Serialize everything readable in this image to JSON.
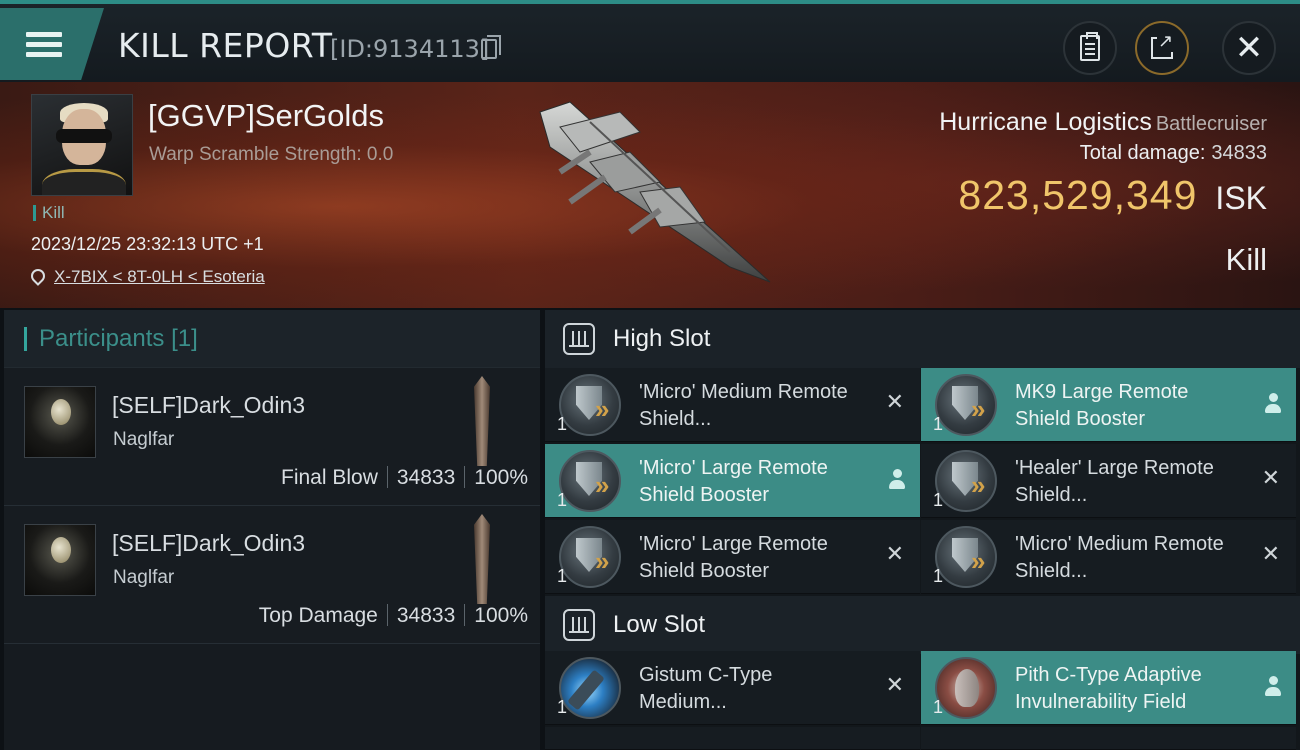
{
  "header": {
    "title": "KILL REPORT",
    "report_id": "[ID:9134113]"
  },
  "victim": {
    "pilot_name": "[GGVP]SerGolds",
    "warp_scramble": "Warp Scramble Strength: 0.0",
    "tag": "Kill",
    "datetime": "2023/12/25 23:32:13 UTC +1",
    "location": "X-7BIX < 8T-0LH < Esoteria",
    "ship_name": "Hurricane Logistics",
    "ship_class": "Battlecruiser",
    "total_damage_label": "Total damage:",
    "total_damage": "34833",
    "isk_value": "823,529,349",
    "isk_unit": "ISK",
    "result": "Kill"
  },
  "participants": {
    "header_label": "Participants",
    "count": "[1]",
    "rows": [
      {
        "name": "[SELF]Dark_Odin3",
        "ship": "Naglfar",
        "role": "Final Blow",
        "damage": "34833",
        "percent": "100%"
      },
      {
        "name": "[SELF]Dark_Odin3",
        "ship": "Naglfar",
        "role": "Top Damage",
        "damage": "34833",
        "percent": "100%"
      }
    ]
  },
  "slots": {
    "high_label": "High Slot",
    "low_label": "Low Slot",
    "high": [
      {
        "name": "'Micro' Medium Remote Shield...",
        "qty": "1",
        "status": "destroyed",
        "icon": "shield-booster-icon"
      },
      {
        "name": "MK9 Large Remote Shield Booster",
        "qty": "1",
        "status": "dropped",
        "icon": "shield-booster-icon"
      },
      {
        "name": "'Micro' Large Remote Shield Booster",
        "qty": "1",
        "status": "dropped",
        "icon": "shield-booster-icon"
      },
      {
        "name": "'Healer' Large Remote Shield...",
        "qty": "1",
        "status": "destroyed",
        "icon": "shield-booster-icon"
      },
      {
        "name": "'Micro' Large Remote Shield Booster",
        "qty": "1",
        "status": "destroyed",
        "icon": "shield-booster-icon"
      },
      {
        "name": "'Micro' Medium Remote Shield...",
        "qty": "1",
        "status": "destroyed",
        "icon": "shield-booster-icon"
      }
    ],
    "low": [
      {
        "name": "Gistum C-Type Medium...",
        "qty": "1",
        "status": "destroyed",
        "icon": "shield-extender-icon"
      },
      {
        "name": "Pith C-Type Adaptive Invulnerability Field",
        "qty": "1",
        "status": "dropped",
        "icon": "invulnerability-field-icon"
      }
    ]
  },
  "colors": {
    "accent": "#2d8c86",
    "active_slot": "#3c8c86",
    "isk": "#f0c56a"
  }
}
